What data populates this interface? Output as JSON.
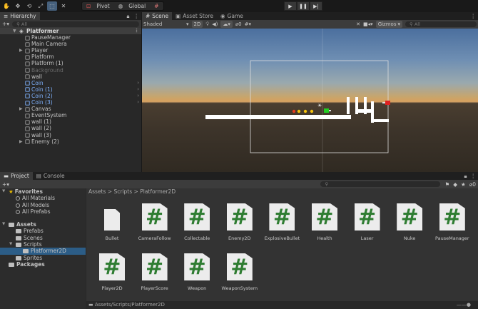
{
  "toolbar": {
    "pivot_label": "Pivot",
    "global_label": "Global",
    "tools": [
      "hand-tool",
      "move-tool",
      "rotate-tool",
      "scale-tool",
      "rect-tool",
      "transform-tool"
    ]
  },
  "hierarchy": {
    "tab_label": "Hierarchy",
    "search_placeholder": "All",
    "root": "Platformer",
    "items": [
      {
        "label": "PauseManager",
        "indent": 2,
        "expand": false,
        "style": "normal"
      },
      {
        "label": "Main Camera",
        "indent": 2,
        "expand": false,
        "style": "normal"
      },
      {
        "label": "Player",
        "indent": 2,
        "expand": true,
        "style": "normal"
      },
      {
        "label": "Platform",
        "indent": 2,
        "expand": false,
        "style": "normal"
      },
      {
        "label": "Platform (1)",
        "indent": 2,
        "expand": false,
        "style": "normal"
      },
      {
        "label": "Background",
        "indent": 2,
        "expand": false,
        "style": "grey"
      },
      {
        "label": "wall",
        "indent": 2,
        "expand": false,
        "style": "normal"
      },
      {
        "label": "Coin",
        "indent": 2,
        "expand": false,
        "style": "blue"
      },
      {
        "label": "Coin (1)",
        "indent": 2,
        "expand": false,
        "style": "blue"
      },
      {
        "label": "Coin (2)",
        "indent": 2,
        "expand": false,
        "style": "blue"
      },
      {
        "label": "Coin (3)",
        "indent": 2,
        "expand": false,
        "style": "blue"
      },
      {
        "label": "Canvas",
        "indent": 2,
        "expand": true,
        "style": "normal"
      },
      {
        "label": "EventSystem",
        "indent": 2,
        "expand": false,
        "style": "normal"
      },
      {
        "label": "wall (1)",
        "indent": 2,
        "expand": false,
        "style": "normal"
      },
      {
        "label": "wall (2)",
        "indent": 2,
        "expand": false,
        "style": "normal"
      },
      {
        "label": "wall (3)",
        "indent": 2,
        "expand": false,
        "style": "normal"
      },
      {
        "label": "Enemy (2)",
        "indent": 2,
        "expand": true,
        "style": "normal"
      }
    ]
  },
  "scene": {
    "tabs": [
      "Scene",
      "Asset Store",
      "Game"
    ],
    "shading": "Shaded",
    "mode_2d": "2D",
    "layer_count": "0",
    "gizmos_label": "Gizmos",
    "search_placeholder": "All",
    "colors": {
      "sky_top": "#4b6f9e",
      "horizon": "#d8a05d",
      "ground": "#3d342a",
      "platform": "#ffffff",
      "coin_red": "#e53b1f",
      "coin_yellow": "#f4c20d",
      "player": "#22cc22",
      "enemy": "#dd2222"
    }
  },
  "project": {
    "tabs": [
      "Project",
      "Console"
    ],
    "search_placeholder": "",
    "hidden_count": "0",
    "tree": [
      {
        "label": "Favorites",
        "kind": "favorites",
        "indent": 0
      },
      {
        "label": "All Materials",
        "kind": "search",
        "indent": 1
      },
      {
        "label": "All Models",
        "kind": "search",
        "indent": 1
      },
      {
        "label": "All Prefabs",
        "kind": "search",
        "indent": 1
      },
      {
        "label": "Assets",
        "kind": "folder-root",
        "indent": 0
      },
      {
        "label": "Prefabs",
        "kind": "folder",
        "indent": 1
      },
      {
        "label": "Scenes",
        "kind": "folder",
        "indent": 1
      },
      {
        "label": "Scripts",
        "kind": "folder",
        "indent": 1
      },
      {
        "label": "Platformer2D",
        "kind": "folder-selected",
        "indent": 2
      },
      {
        "label": "Sprites",
        "kind": "folder",
        "indent": 1
      },
      {
        "label": "Packages",
        "kind": "folder-root",
        "indent": 0
      }
    ],
    "breadcrumb": [
      "Assets",
      "Scripts",
      "Platformer2D"
    ],
    "assets": [
      {
        "label": "Bullet",
        "type": "blank"
      },
      {
        "label": "CameraFollow",
        "type": "script"
      },
      {
        "label": "Collectable",
        "type": "script"
      },
      {
        "label": "Enemy2D",
        "type": "script"
      },
      {
        "label": "ExplosiveBullet",
        "type": "script"
      },
      {
        "label": "Health",
        "type": "script"
      },
      {
        "label": "Laser",
        "type": "script"
      },
      {
        "label": "Nuke",
        "type": "script"
      },
      {
        "label": "PauseManager",
        "type": "script"
      },
      {
        "label": "Player2D",
        "type": "script"
      },
      {
        "label": "PlayerScore",
        "type": "script"
      },
      {
        "label": "Weapon",
        "type": "script"
      },
      {
        "label": "WeaponSystem",
        "type": "script"
      }
    ],
    "script_glyph": "#",
    "status_path": "Assets/Scripts/Platformer2D"
  }
}
